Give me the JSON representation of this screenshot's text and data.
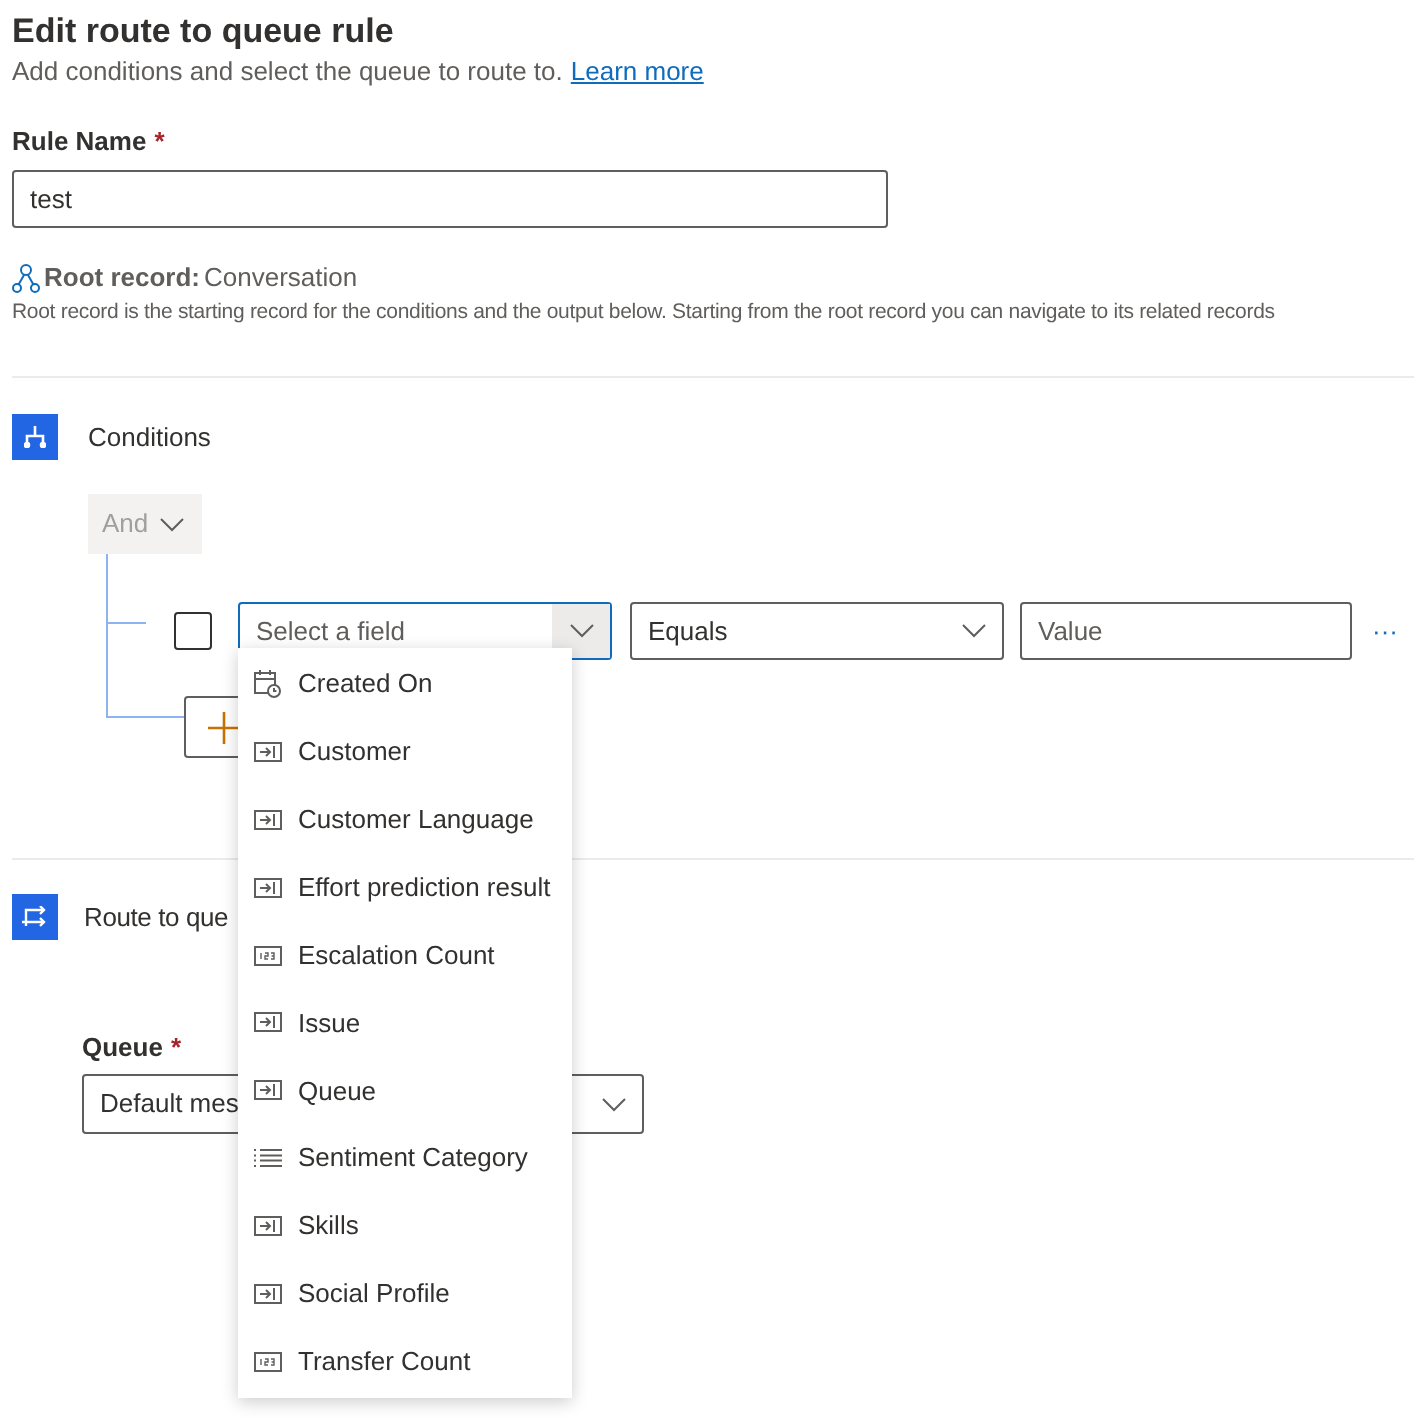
{
  "header": {
    "title": "Edit route to queue rule",
    "subtitle": "Add conditions and select the queue to route to.",
    "link": "Learn more"
  },
  "rule_name": {
    "label": "Rule Name",
    "required_mark": "*",
    "value": "test"
  },
  "root_record": {
    "label": "Root record:",
    "value": "Conversation",
    "description": "Root record is the starting record for the conditions and the output below. Starting from the root record you can navigate to its related records"
  },
  "conditions": {
    "title": "Conditions",
    "group_operator": "And",
    "row": {
      "checked": false,
      "field_placeholder": "Select a field",
      "operator": "Equals",
      "value_placeholder": "Value",
      "more": "···"
    }
  },
  "field_menu": [
    {
      "label": "Created On",
      "kind": "date"
    },
    {
      "label": "Customer",
      "kind": "lookup"
    },
    {
      "label": "Customer Language",
      "kind": "lookup"
    },
    {
      "label": "Effort prediction result",
      "kind": "lookup"
    },
    {
      "label": "Escalation Count",
      "kind": "number"
    },
    {
      "label": "Issue",
      "kind": "lookup"
    },
    {
      "label": "Queue",
      "kind": "lookup"
    },
    {
      "label": "Sentiment Category",
      "kind": "optionset"
    },
    {
      "label": "Skills",
      "kind": "lookup"
    },
    {
      "label": "Social Profile",
      "kind": "lookup"
    },
    {
      "label": "Transfer Count",
      "kind": "number"
    }
  ],
  "route": {
    "title": "Route to que",
    "queue_label": "Queue",
    "required_mark": "*",
    "queue_value": "Default mes"
  }
}
